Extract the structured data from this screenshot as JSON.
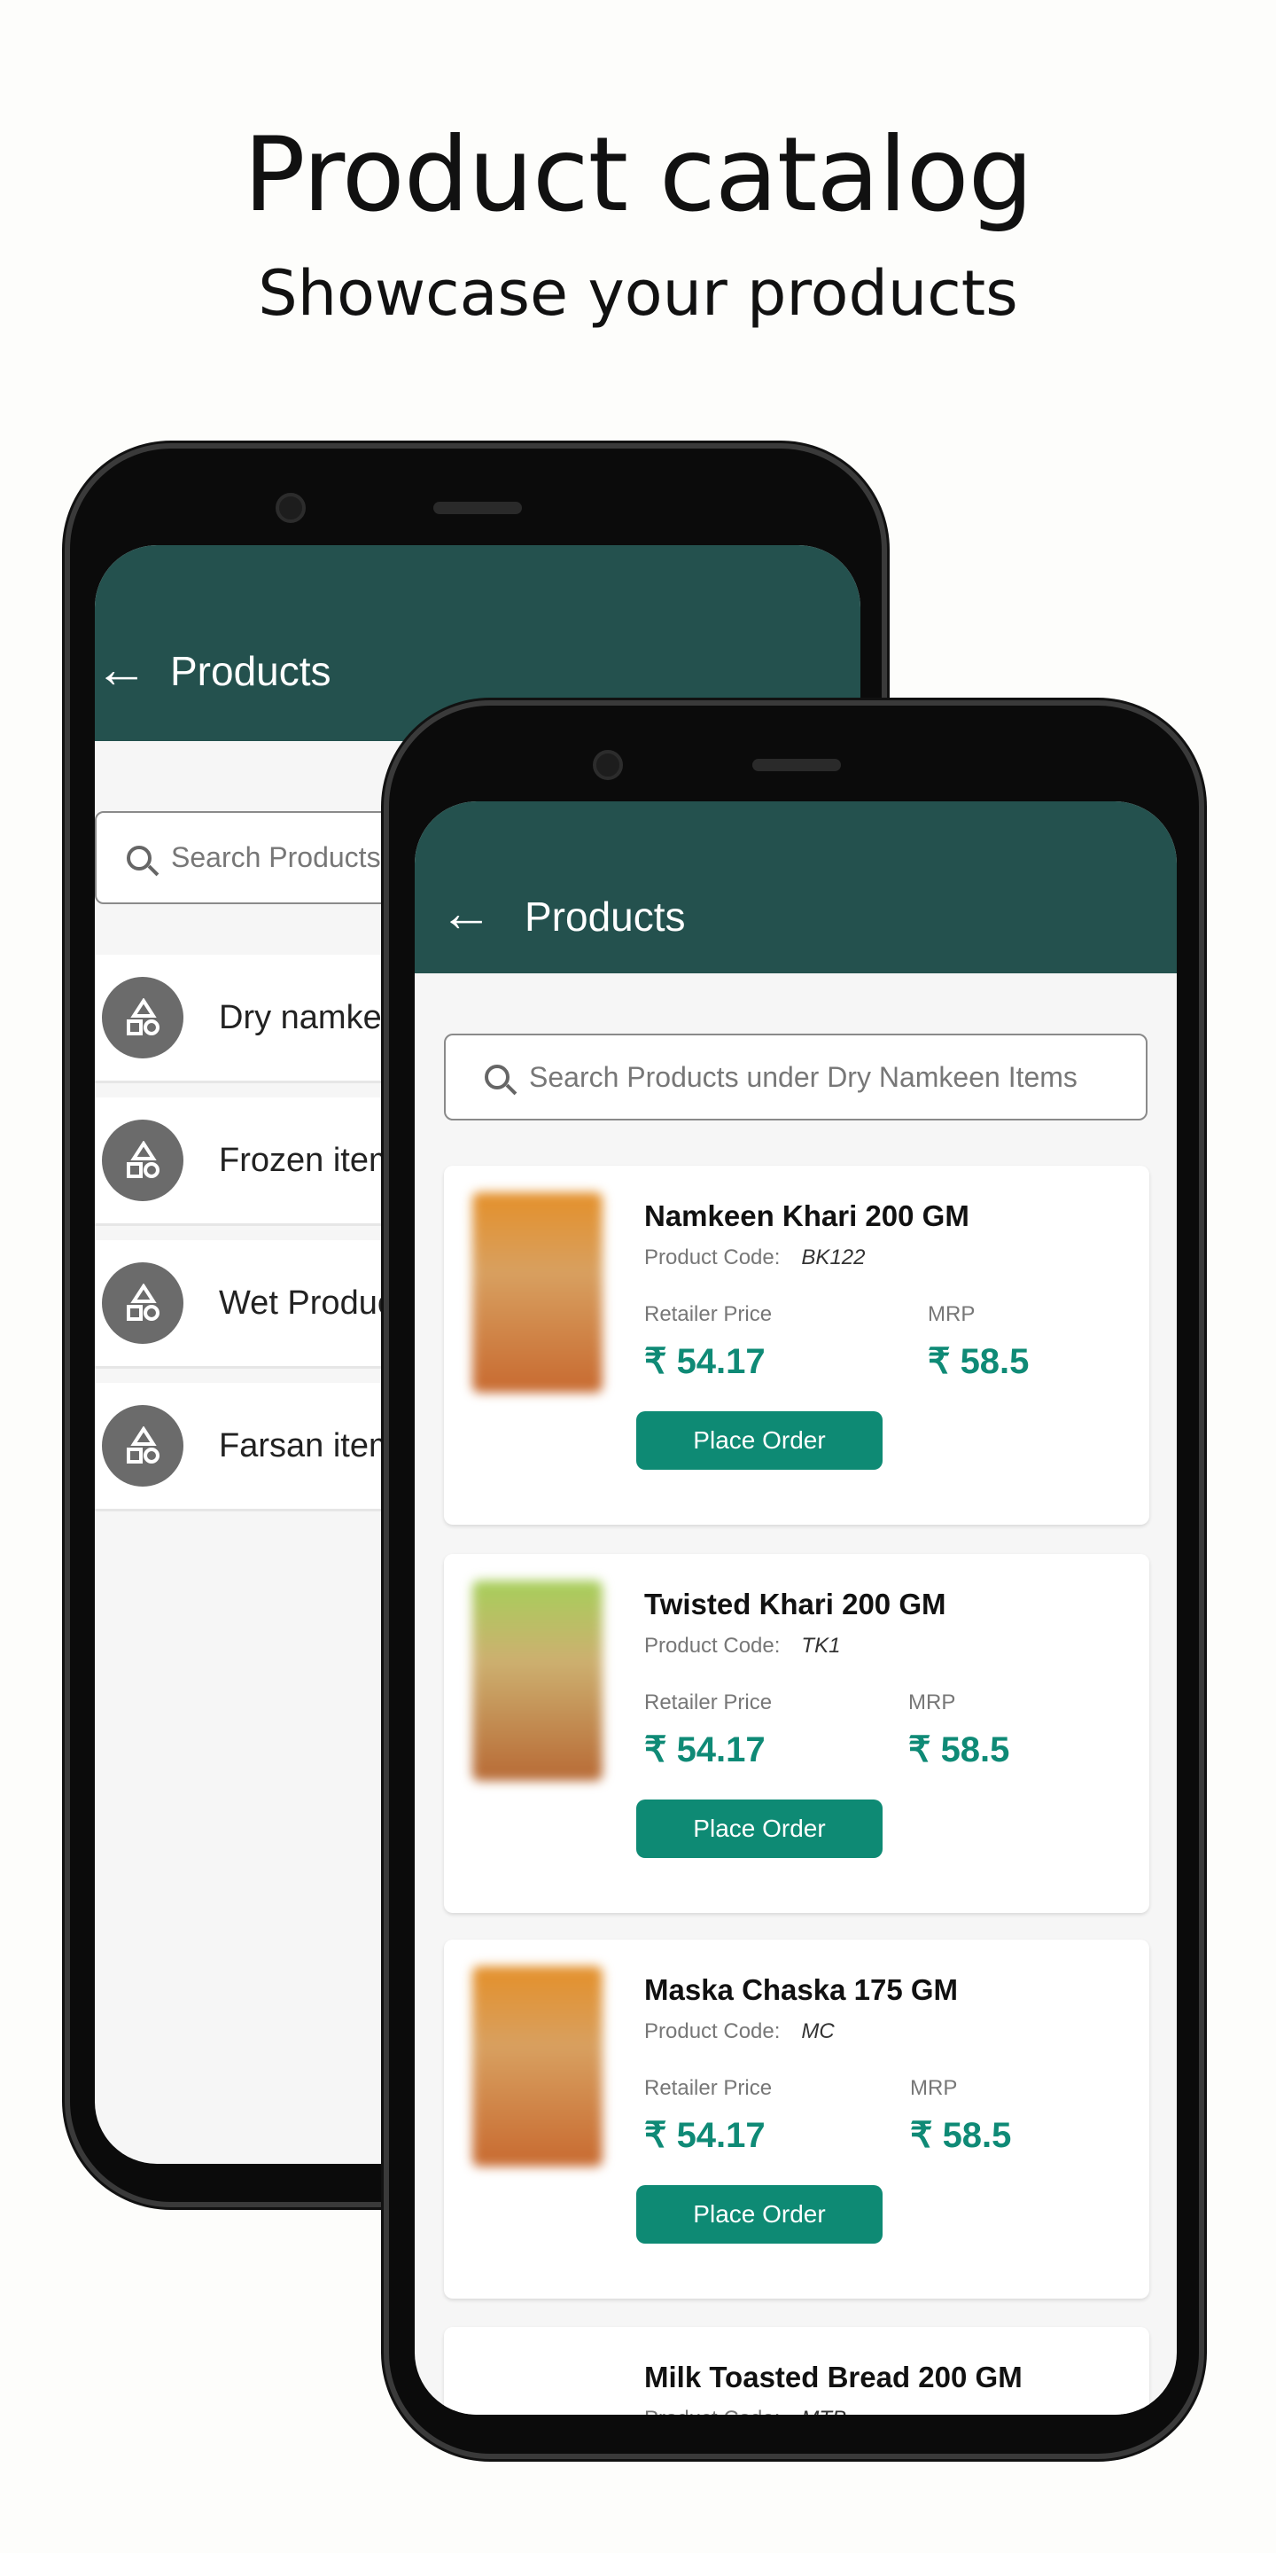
{
  "hero": {
    "title": "Product catalog",
    "subtitle": "Showcase your products"
  },
  "colors": {
    "header": "#24514e",
    "accent": "#0e8a74",
    "price": "#0f8a76"
  },
  "back_phone": {
    "header_title": "Products",
    "search_placeholder": "Search Products",
    "categories": [
      {
        "label": "Dry namkeen"
      },
      {
        "label": "Frozen items"
      },
      {
        "label": "Wet Products"
      },
      {
        "label": "Farsan items"
      }
    ]
  },
  "front_phone": {
    "header_title": "Products",
    "search_placeholder": "Search Products under Dry Namkeen Items",
    "labels": {
      "code": "Product Code:",
      "retailer": "Retailer Price",
      "mrp": "MRP",
      "order": "Place Order"
    },
    "products": [
      {
        "name": "Namkeen Khari 200 GM",
        "code": "BK122",
        "retailer_price": "₹ 54.17",
        "mrp": "₹ 58.5"
      },
      {
        "name": "Twisted Khari 200 GM",
        "code": "TK1",
        "retailer_price": "₹ 54.17",
        "mrp": "₹ 58.5"
      },
      {
        "name": "Maska Chaska 175 GM",
        "code": "MC",
        "retailer_price": "₹ 54.17",
        "mrp": "₹ 58.5"
      },
      {
        "name": "Milk Toasted Bread 200 GM",
        "code": "MTB"
      }
    ]
  }
}
